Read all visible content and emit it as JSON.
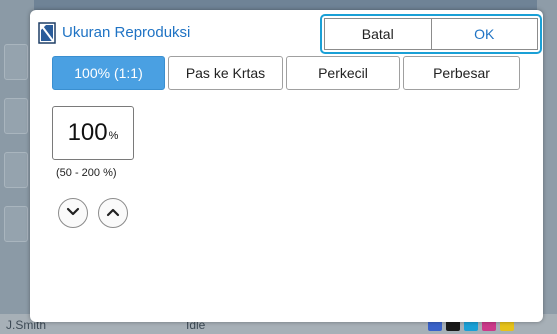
{
  "background": {
    "user": "J.Smith",
    "status": "Idle",
    "ink_colors": [
      "#3a62c9",
      "#1a1a1a",
      "#1aa0d6",
      "#cc3a8a",
      "#e6c21a"
    ]
  },
  "dialog": {
    "title": "Ukuran Reproduksi",
    "cancel_label": "Batal",
    "ok_label": "OK",
    "tabs": [
      {
        "label": "100% (1:1)",
        "active": true
      },
      {
        "label": "Pas ke Krtas",
        "active": false
      },
      {
        "label": "Perkecil",
        "active": false
      },
      {
        "label": "Perbesar",
        "active": false
      }
    ],
    "value": "100",
    "unit": "%",
    "range": "(50 - 200 %)",
    "decrease_icon": "chevron-down-icon",
    "increase_icon": "chevron-up-icon"
  },
  "colors": {
    "accent": "#1f73c4",
    "tab_active": "#4aa0e2",
    "highlight_border": "#1aa0d6"
  }
}
